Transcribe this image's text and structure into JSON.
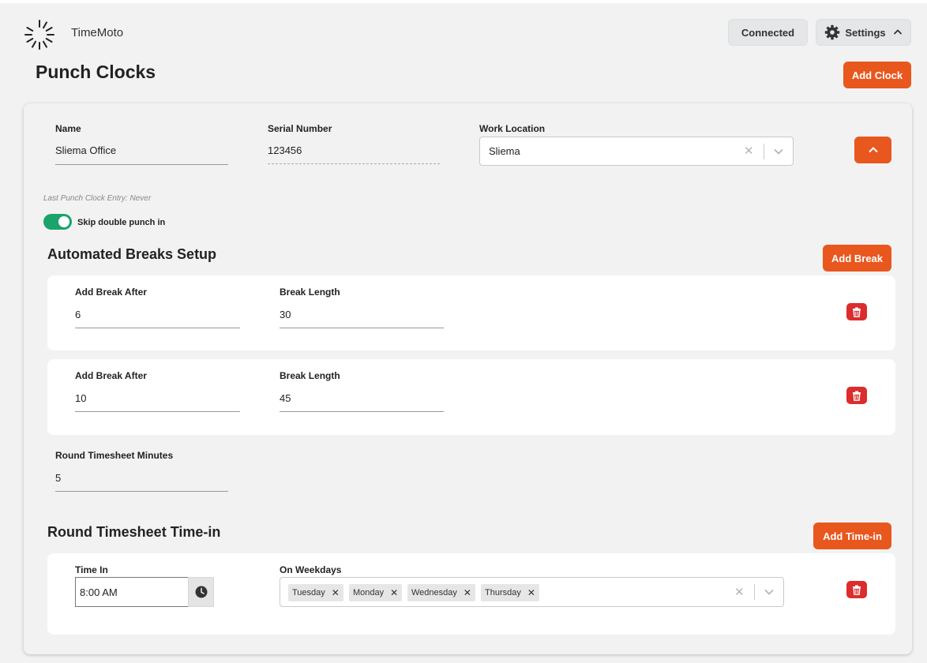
{
  "app": {
    "name": "TimeMoto"
  },
  "header": {
    "status_label": "Connected",
    "settings_label": "Settings"
  },
  "page": {
    "title": "Punch Clocks",
    "add_clock_label": "Add Clock"
  },
  "clock": {
    "name_label": "Name",
    "name_value": "Sliema Office",
    "serial_label": "Serial Number",
    "serial_value": "123456",
    "location_label": "Work Location",
    "location_value": "Sliema",
    "last_entry": "Last Punch Clock Entry: Never",
    "skip_double_label": "Skip double punch in",
    "skip_double_enabled": true
  },
  "breaks": {
    "title": "Automated Breaks Setup",
    "add_label": "Add Break",
    "items": [
      {
        "after_label": "Add Break After",
        "after_value": "6",
        "length_label": "Break Length",
        "length_value": "30"
      },
      {
        "after_label": "Add Break After",
        "after_value": "10",
        "length_label": "Break Length",
        "length_value": "45"
      }
    ]
  },
  "rounding": {
    "minutes_label": "Round Timesheet Minutes",
    "minutes_value": "5"
  },
  "time_in": {
    "title": "Round Timesheet Time-in",
    "add_label": "Add Time-in",
    "time_label": "Time In",
    "time_value": "8:00 AM",
    "weekdays_label": "On Weekdays",
    "weekdays": [
      "Tuesday",
      "Monday",
      "Wednesday",
      "Thursday"
    ]
  },
  "colors": {
    "accent": "#e8571e",
    "danger": "#dc2c2c",
    "toggle_on": "#1aa36b"
  },
  "icons": [
    "loading-spinner-icon",
    "gear-icon",
    "chevron-up-icon",
    "clear-x-icon",
    "chevron-down-icon",
    "trash-icon",
    "clock-icon"
  ]
}
